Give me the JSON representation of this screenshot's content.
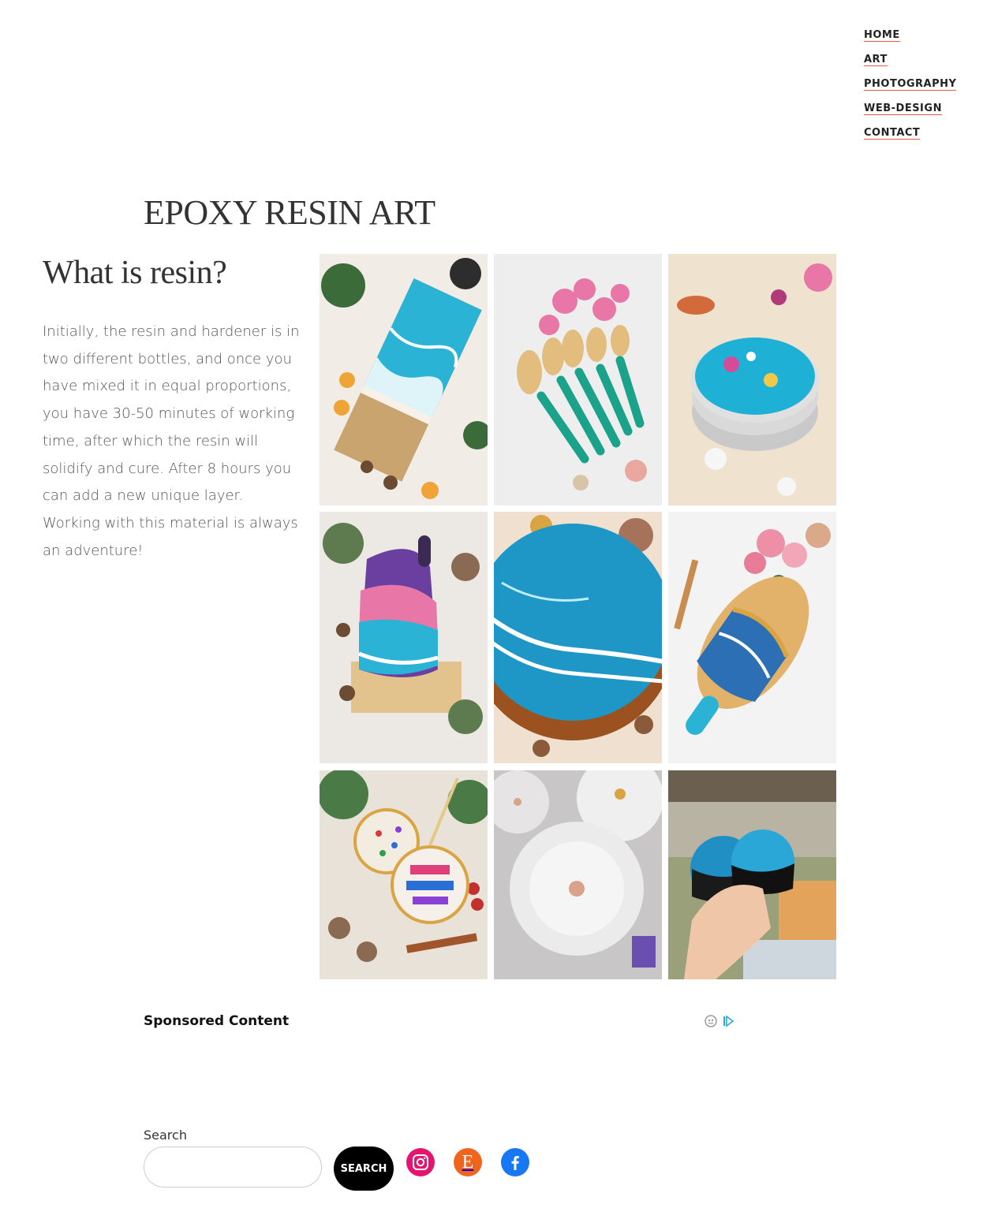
{
  "nav": {
    "items": [
      {
        "label": "HOME"
      },
      {
        "label": "ART"
      },
      {
        "label": "PHOTOGRAPHY"
      },
      {
        "label": "WEB-DESIGN"
      },
      {
        "label": "CONTACT"
      }
    ]
  },
  "page": {
    "title": "EPOXY RESIN ART"
  },
  "content": {
    "heading": "What is resin?",
    "body": "Initially, the resin and hardener is in two different bottles, and once you have mixed it in equal proportions, you have 30-50 minutes of working time, after which the resin will solidify and cure. After 8 hours you can add a new unique layer. Working with this material is always an adventure!"
  },
  "gallery": {
    "images": [
      {
        "subject": "ocean-resin-serving-board-with-oranges"
      },
      {
        "subject": "bamboo-utensils-with-teal-resin-handles"
      },
      {
        "subject": "turquoise-resin-coasters-with-flowers"
      },
      {
        "subject": "purple-pink-ocean-cutting-board"
      },
      {
        "subject": "round-ocean-wave-resin-board"
      },
      {
        "subject": "gold-blue-geode-cheese-board"
      },
      {
        "subject": "holiday-resin-ornament"
      },
      {
        "subject": "white-flower-resin-coasters"
      },
      {
        "subject": "hand-holding-ocean-resin-coasters"
      }
    ],
    "colors": {
      "ocean": "#2bb3d6",
      "foam": "#ffffff",
      "sand": "#e8d8c0",
      "teal": "#1aa38a",
      "pink": "#e877a8",
      "purple": "#6a3fa0",
      "gold": "#d9a441",
      "wood": "#c98c4f"
    }
  },
  "sponsored": {
    "label": "Sponsored Content"
  },
  "search": {
    "label": "Search",
    "placeholder": "",
    "value": "",
    "button_label": "SEARCH"
  },
  "social": {
    "links": [
      {
        "icon": "instagram-icon",
        "color": "#e4156f"
      },
      {
        "icon": "etsy-icon",
        "color": "#f1641e",
        "glyph": "E"
      },
      {
        "icon": "facebook-icon",
        "color": "#1877f2"
      }
    ]
  }
}
